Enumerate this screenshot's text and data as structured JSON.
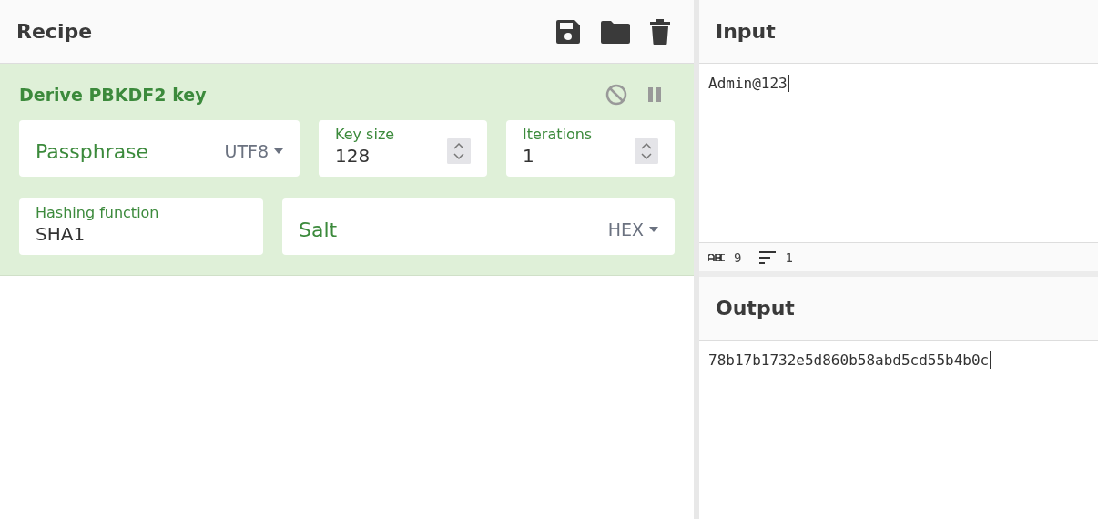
{
  "recipe": {
    "title": "Recipe"
  },
  "operation": {
    "name": "Derive PBKDF2 key",
    "disabled": false,
    "breakpoint": false,
    "rows": [
      [
        {
          "kind": "toggle-string",
          "label": "Passphrase",
          "option": "UTF8"
        },
        {
          "kind": "number",
          "label": "Key size",
          "value": "128"
        },
        {
          "kind": "number",
          "label": "Iterations",
          "value": "1"
        }
      ],
      [
        {
          "kind": "select",
          "label": "Hashing function",
          "value": "SHA1"
        },
        {
          "kind": "toggle-string",
          "label": "Salt",
          "option": "HEX"
        }
      ]
    ]
  },
  "input": {
    "title": "Input",
    "value": "Admin@123",
    "length": "9",
    "lines": "1"
  },
  "output": {
    "title": "Output",
    "value": "78b17b1732e5d860b58abd5cd55b4b0c"
  }
}
